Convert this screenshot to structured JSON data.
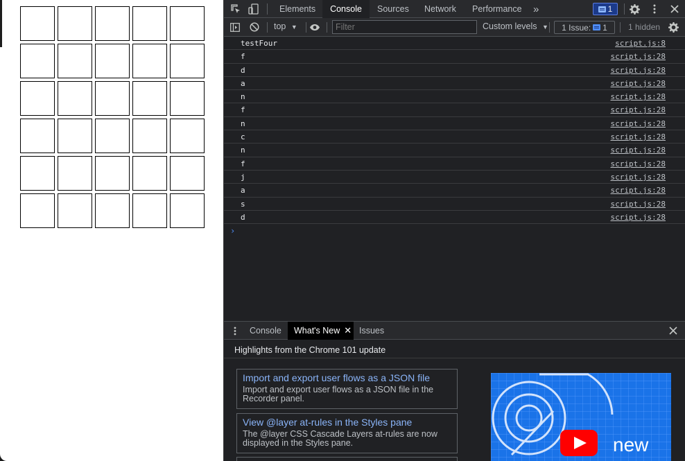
{
  "page": {
    "grid": {
      "rows": 6,
      "cols": 5
    }
  },
  "devtools": {
    "tabs": [
      {
        "label": "Elements",
        "active": false
      },
      {
        "label": "Console",
        "active": true
      },
      {
        "label": "Sources",
        "active": false
      },
      {
        "label": "Network",
        "active": false
      },
      {
        "label": "Performance",
        "active": false
      }
    ],
    "overflow_label": "»",
    "issues_badge_count": "1",
    "toolbar": {
      "context": "top",
      "filter_placeholder": "Filter",
      "levels_label": "Custom levels",
      "issues_label": "1 Issue:",
      "issues_count": "1",
      "hidden_label": "1 hidden"
    },
    "console_rows": [
      {
        "msg": "testFour",
        "src": "script.js:8"
      },
      {
        "msg": "f",
        "src": "script.js:28"
      },
      {
        "msg": "d",
        "src": "script.js:28"
      },
      {
        "msg": "a",
        "src": "script.js:28"
      },
      {
        "msg": "n",
        "src": "script.js:28"
      },
      {
        "msg": "f",
        "src": "script.js:28"
      },
      {
        "msg": "n",
        "src": "script.js:28"
      },
      {
        "msg": "c",
        "src": "script.js:28"
      },
      {
        "msg": "n",
        "src": "script.js:28"
      },
      {
        "msg": "f",
        "src": "script.js:28"
      },
      {
        "msg": "j",
        "src": "script.js:28"
      },
      {
        "msg": "a",
        "src": "script.js:28"
      },
      {
        "msg": "s",
        "src": "script.js:28"
      },
      {
        "msg": "d",
        "src": "script.js:28"
      }
    ],
    "prompt_symbol": "›",
    "drawer": {
      "tabs": [
        {
          "label": "Console",
          "active": false
        },
        {
          "label": "What's New",
          "active": true
        },
        {
          "label": "Issues",
          "active": false
        }
      ],
      "highlights_title": "Highlights from the Chrome 101 update",
      "cards": [
        {
          "title": "Import and export user flows as a JSON file",
          "desc": "Import and export user flows as a JSON file in the Recorder panel."
        },
        {
          "title": "View @layer at-rules in the Styles pane",
          "desc": "The @layer CSS Cascade Layers at-rules are now displayed in the Styles pane."
        }
      ],
      "promo_text": "new"
    },
    "colors": {
      "accent": "#8ab4f8",
      "panel_bg": "#202124",
      "toolbar_bg": "#292a2d",
      "promo_bg": "#1a73e8"
    }
  }
}
